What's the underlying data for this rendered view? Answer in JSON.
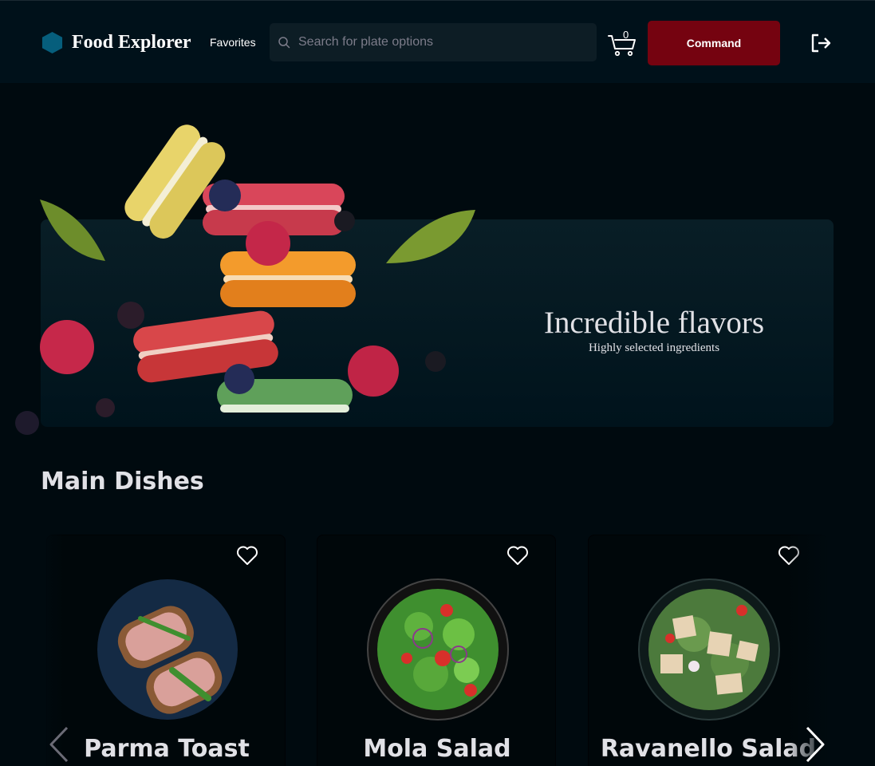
{
  "header": {
    "logo_text": "Food Explorer",
    "favorites_label": "Favorites",
    "search_placeholder": "Search for plate options",
    "cart_count": "0",
    "command_label": "Command",
    "logo_icon": "hexagon-icon",
    "search_icon": "search-icon",
    "cart_icon": "cart-icon",
    "logout_icon": "logout-icon"
  },
  "banner": {
    "title": "Incredible flavors",
    "subtitle": "Highly selected ingredients"
  },
  "main_dishes": {
    "title": "Main Dishes",
    "items": [
      {
        "name": "Parma Toast"
      },
      {
        "name": "Mola Salad"
      },
      {
        "name": "Ravanello Salad"
      }
    ]
  },
  "colors": {
    "accent": "#750310",
    "header_bg": "#00111a",
    "page_bg": "#000a0f",
    "logo": "#065e7c"
  }
}
